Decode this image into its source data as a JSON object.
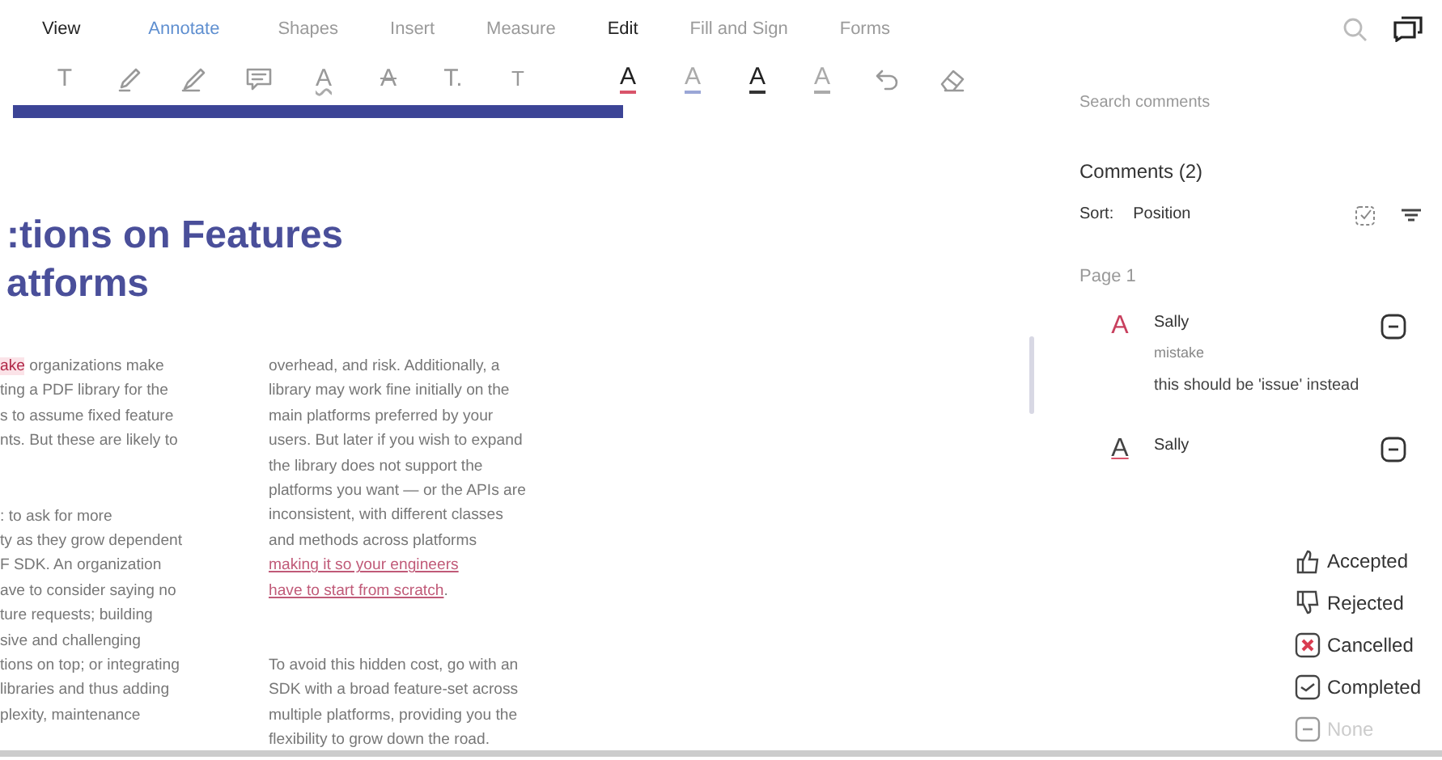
{
  "menu": [
    {
      "label": "View",
      "selected": false,
      "disabled": false
    },
    {
      "label": "Annotate",
      "selected": true,
      "disabled": false
    },
    {
      "label": "Shapes",
      "selected": false,
      "disabled": true
    },
    {
      "label": "Insert",
      "selected": false,
      "disabled": true
    },
    {
      "label": "Measure",
      "selected": false,
      "disabled": true
    },
    {
      "label": "Edit",
      "selected": false,
      "disabled": false
    },
    {
      "label": "Fill and Sign",
      "selected": false,
      "disabled": true
    },
    {
      "label": "Forms",
      "selected": false,
      "disabled": true
    }
  ],
  "toolbar": [
    {
      "kind": "plain",
      "label": "T"
    },
    {
      "kind": "highlighter"
    },
    {
      "kind": "pen"
    },
    {
      "kind": "comment"
    },
    {
      "kind": "squiggle",
      "label": "A"
    },
    {
      "kind": "strike",
      "label": "A"
    },
    {
      "kind": "plain",
      "label": "T."
    },
    {
      "kind": "sub",
      "label": "T"
    },
    {
      "kind": "gap"
    },
    {
      "kind": "underline",
      "label": "A",
      "color": "#d9546a",
      "strong": true
    },
    {
      "kind": "underline",
      "label": "A",
      "color": "#9aa6d6",
      "strong": false
    },
    {
      "kind": "underline",
      "label": "A",
      "color": "#333333",
      "strong": true
    },
    {
      "kind": "underline",
      "label": "A",
      "color": "#aaaaaa",
      "strong": false
    },
    {
      "kind": "undo"
    },
    {
      "kind": "eraser"
    }
  ],
  "document": {
    "heading": [
      ":tions on Features",
      "atforms"
    ],
    "columns": [
      [
        {
          "lines": [
            [
              {
                "text": "ake",
                "strike": true
              },
              {
                "text": " organizations make",
                "strike": false
              }
            ],
            [
              {
                "text": "ting a PDF library for the",
                "strike": false
              }
            ],
            [
              {
                "text": "s to assume fixed feature",
                "strike": false
              }
            ],
            [
              {
                "text": "nts. But these are likely to",
                "strike": false
              }
            ]
          ]
        },
        {
          "lines": [
            [
              {
                "text": ": to ask for more",
                "strike": false
              }
            ],
            [
              {
                "text": "ty as they grow dependent",
                "strike": false
              }
            ],
            [
              {
                "text": "F SDK. An organization",
                "strike": false
              }
            ],
            [
              {
                "text": "ave to consider saying no",
                "strike": false
              }
            ],
            [
              {
                "text": "ture requests; building",
                "strike": false
              }
            ],
            [
              {
                "text": "sive and challenging",
                "strike": false
              }
            ],
            [
              {
                "text": "tions on top; or integrating",
                "strike": false
              }
            ],
            [
              {
                "text": "libraries and thus adding",
                "strike": false
              }
            ],
            [
              {
                "text": "plexity, maintenance",
                "strike": false
              }
            ]
          ]
        }
      ],
      [
        {
          "lines": [
            [
              {
                "text": "overhead, and risk. Additionally, a",
                "link": false
              }
            ],
            [
              {
                "text": "library may work fine initially on the",
                "link": false
              }
            ],
            [
              {
                "text": "main platforms preferred by your",
                "link": false
              }
            ],
            [
              {
                "text": "users. But later if you wish to expand",
                "link": false
              }
            ],
            [
              {
                "text": "the library does not support the",
                "link": false
              }
            ],
            [
              {
                "text": "platforms you want — or the APIs are",
                "link": false
              }
            ],
            [
              {
                "text": "inconsistent, with different classes",
                "link": false
              }
            ],
            [
              {
                "text": "and methods across platforms",
                "link": false
              }
            ],
            [
              {
                "text": "making it so your engineers",
                "link": true
              }
            ],
            [
              {
                "text": "have to start from scratch",
                "link": true
              },
              {
                "text": ".",
                "link": false
              }
            ]
          ]
        },
        {
          "lines": [
            [
              {
                "text": "To avoid this hidden cost, go with an",
                "link": false
              }
            ],
            [
              {
                "text": "SDK with a broad feature-set across",
                "link": false
              }
            ],
            [
              {
                "text": "multiple platforms, providing you the",
                "link": false
              }
            ],
            [
              {
                "text": "flexibility to grow down the road.",
                "link": false
              }
            ]
          ]
        }
      ]
    ]
  },
  "panel": {
    "search": {
      "placeholder": "Search comments"
    },
    "title": "Comments (2)",
    "sort_label": "Sort:",
    "sort_value": "Position",
    "page": "Page 1",
    "comments": [
      {
        "kind": "strike",
        "icon_letter": "A",
        "author": "Sally",
        "quote": "mistake",
        "body": "this should be 'issue' instead"
      },
      {
        "kind": "underline",
        "icon_letter": "A",
        "author": "Sally"
      }
    ]
  },
  "status_menu": [
    {
      "kind": "thumbs-up",
      "label": "Accepted",
      "disabled": false
    },
    {
      "kind": "thumbs-down",
      "label": "Rejected",
      "disabled": false
    },
    {
      "kind": "cancelled",
      "label": "Cancelled",
      "disabled": false
    },
    {
      "kind": "completed",
      "label": "Completed",
      "disabled": false
    },
    {
      "kind": "none",
      "label": "None",
      "disabled": true
    }
  ]
}
